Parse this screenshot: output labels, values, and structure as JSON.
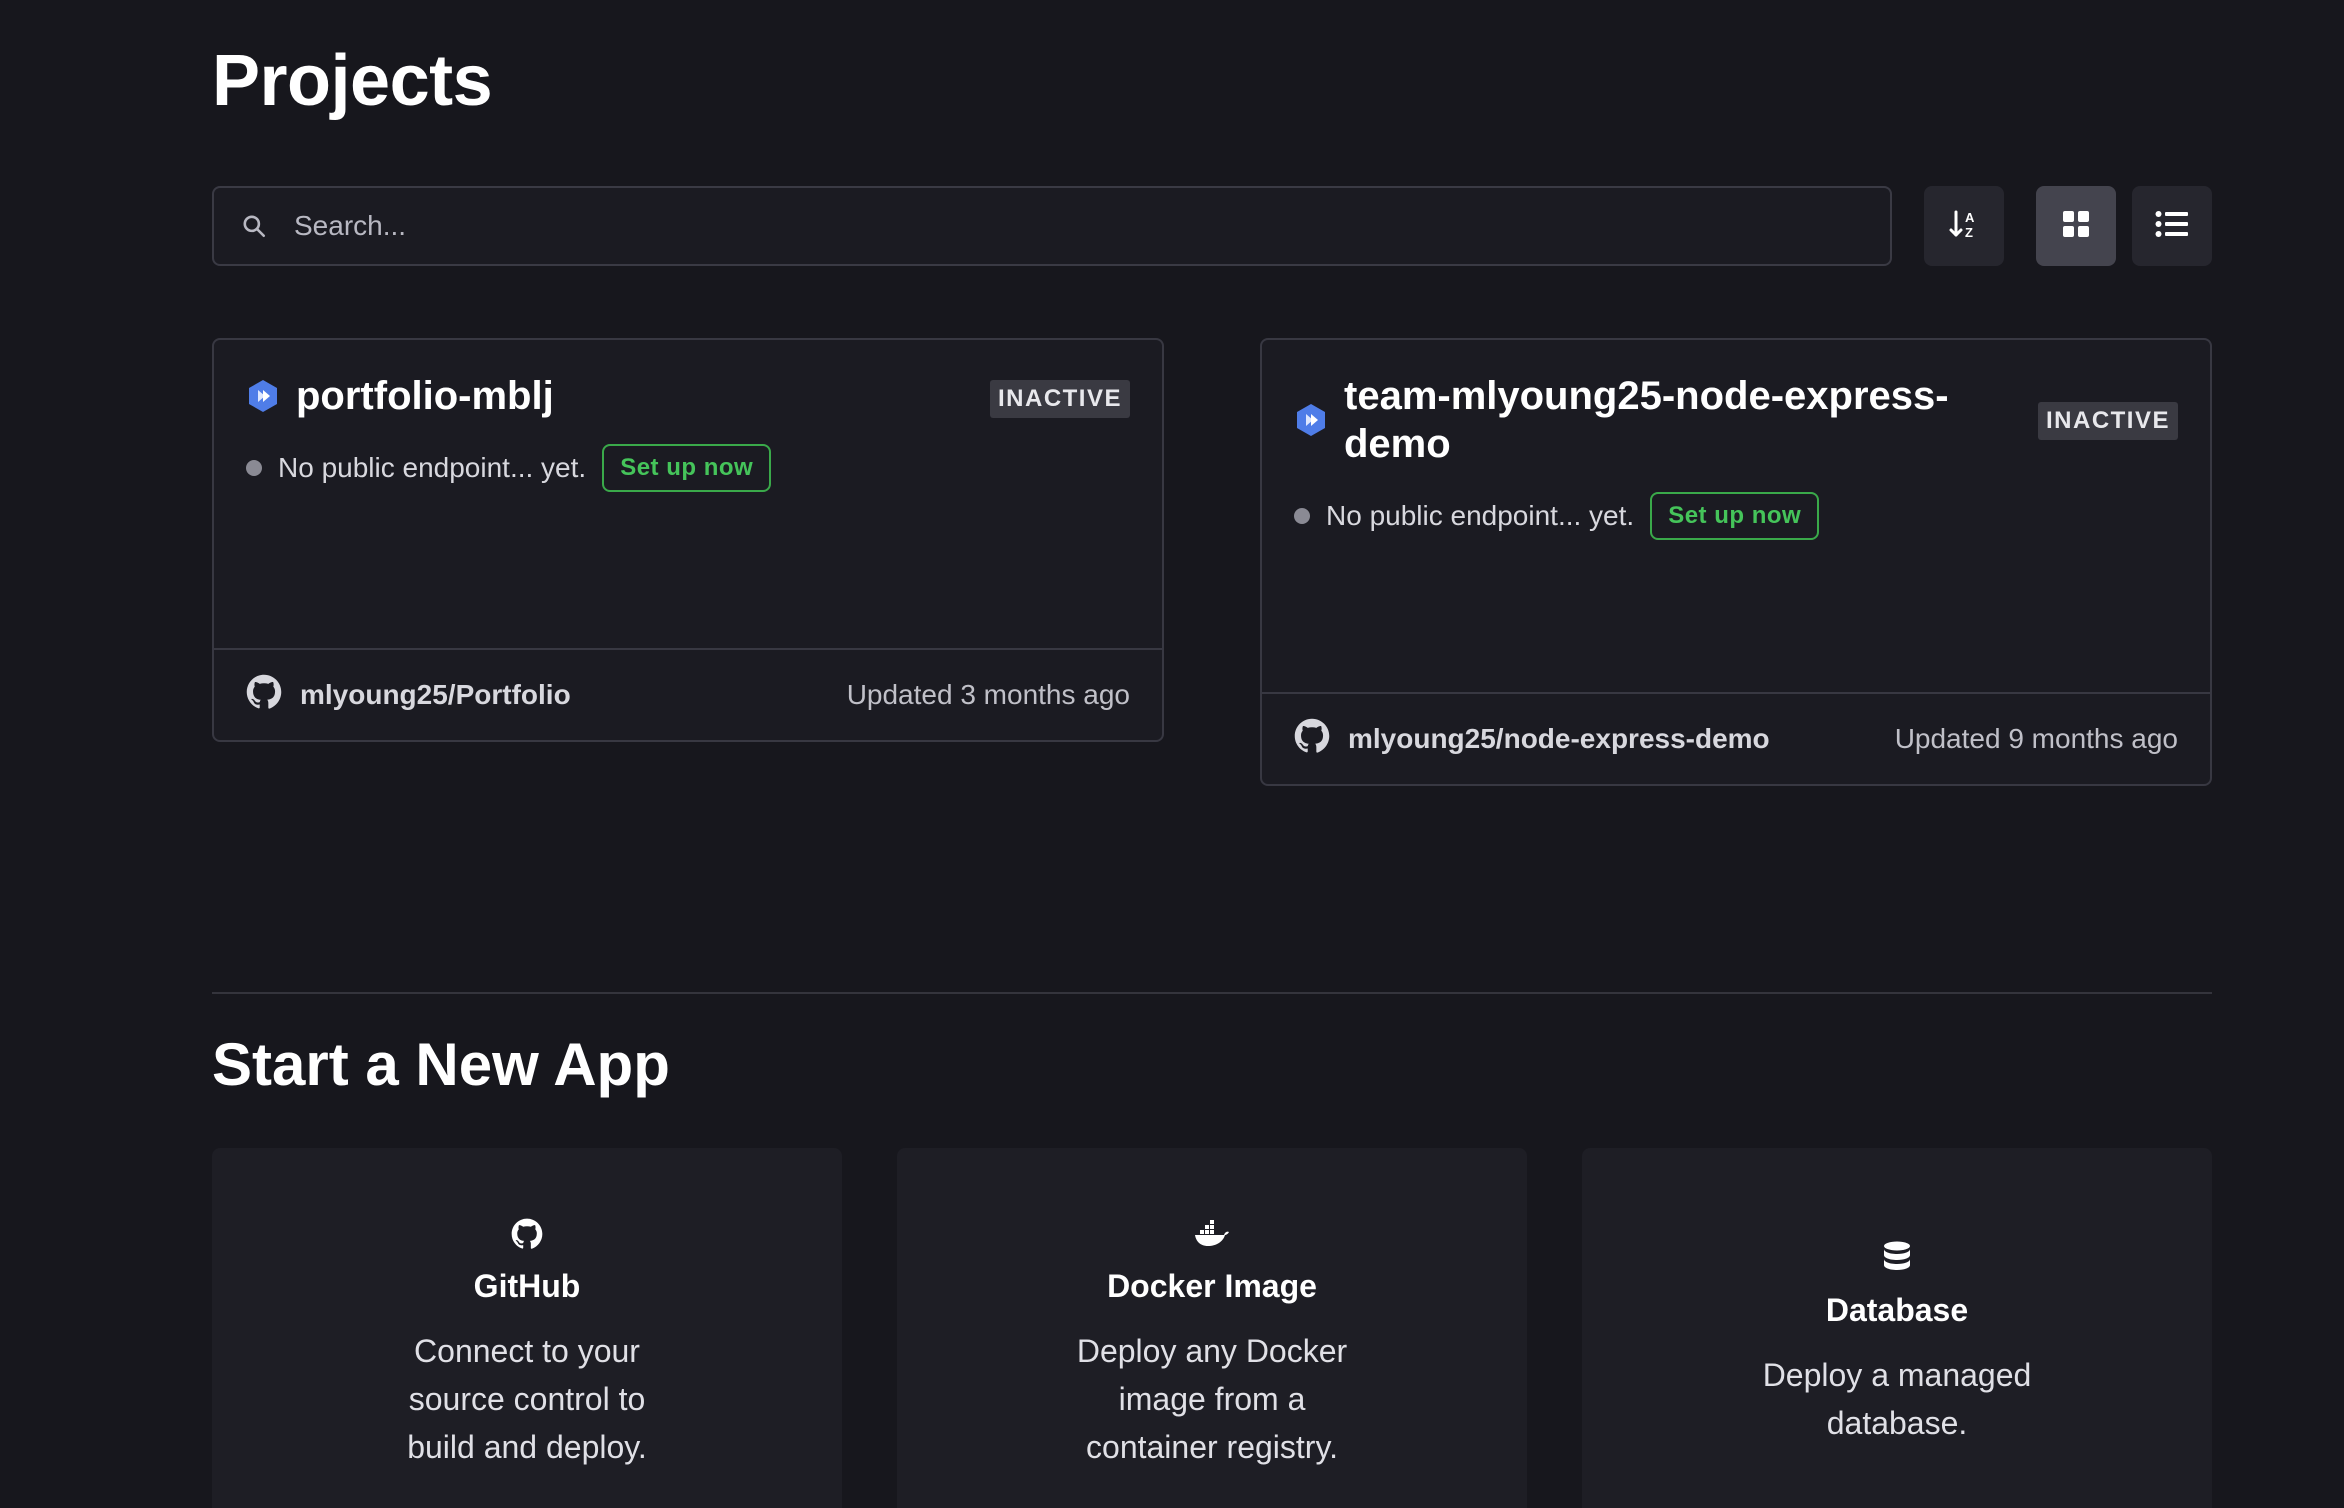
{
  "header": {
    "title": "Projects"
  },
  "search": {
    "placeholder": "Search..."
  },
  "toolbar": {
    "sort_icon": "sort-alpha-down-icon",
    "grid_icon": "grid-view-icon",
    "list_icon": "list-view-icon",
    "active_view": "grid"
  },
  "projects": [
    {
      "name": "portfolio-mblj",
      "status": "INACTIVE",
      "endpoint_text": "No public endpoint... yet.",
      "setup_label": "Set up now",
      "repo": "mlyoung25/Portfolio",
      "updated": "Updated 3 months ago"
    },
    {
      "name": "team-mlyoung25-node-express-demo",
      "status": "INACTIVE",
      "endpoint_text": "No public endpoint... yet.",
      "setup_label": "Set up now",
      "repo": "mlyoung25/node-express-demo",
      "updated": "Updated 9 months ago"
    }
  ],
  "new_app": {
    "title": "Start a New App",
    "options": [
      {
        "icon": "github-icon",
        "title": "GitHub",
        "description": "Connect to your source control to build and deploy."
      },
      {
        "icon": "docker-icon",
        "title": "Docker Image",
        "description": "Deploy any Docker image from a container registry."
      },
      {
        "icon": "database-icon",
        "title": "Database",
        "description": "Deploy a managed database."
      }
    ]
  },
  "colors": {
    "background": "#17171d",
    "accent_green": "#45c45a",
    "service_blue": "#4f7de8"
  }
}
